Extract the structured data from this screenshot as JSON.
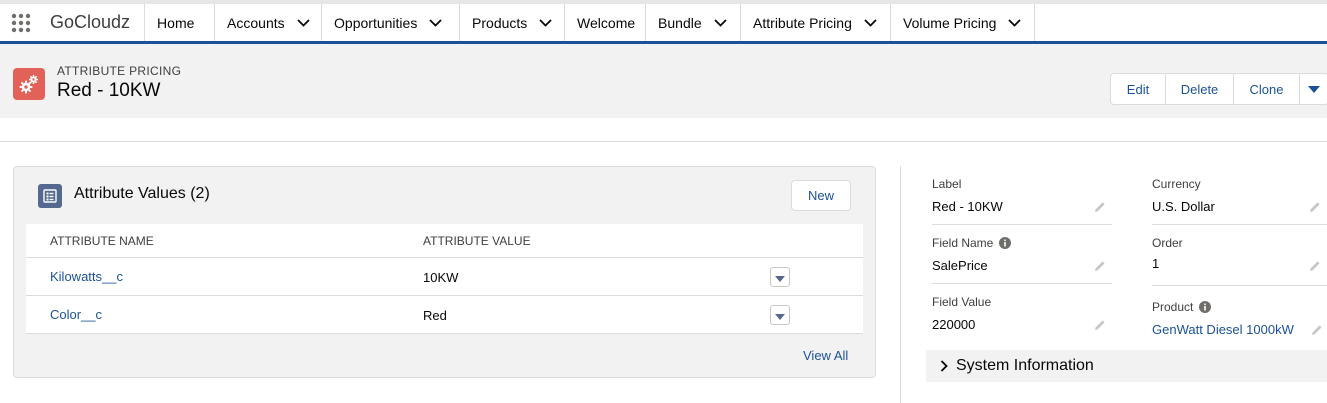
{
  "app": {
    "name": "GoCloudz",
    "nav": [
      {
        "label": "Home",
        "dropdown": false
      },
      {
        "label": "Accounts",
        "dropdown": true
      },
      {
        "label": "Opportunities",
        "dropdown": true
      },
      {
        "label": "Products",
        "dropdown": true
      },
      {
        "label": "Welcome",
        "dropdown": false
      },
      {
        "label": "Bundle",
        "dropdown": true
      },
      {
        "label": "Attribute Pricing",
        "dropdown": true
      },
      {
        "label": "Volume Pricing",
        "dropdown": true
      }
    ]
  },
  "record": {
    "object_type": "ATTRIBUTE PRICING",
    "title": "Red - 10KW",
    "icon": "gears-icon",
    "actions": {
      "edit": "Edit",
      "delete": "Delete",
      "clone": "Clone"
    }
  },
  "related_list": {
    "title": "Attribute Values (2)",
    "new_label": "New",
    "columns": [
      "ATTRIBUTE NAME",
      "ATTRIBUTE VALUE"
    ],
    "rows": [
      {
        "name": "Kilowatts__c",
        "value": "10KW"
      },
      {
        "name": "Color__c",
        "value": "Red"
      }
    ],
    "view_all": "View All"
  },
  "details": {
    "left": [
      {
        "label": "Label",
        "value": "Red - 10KW"
      },
      {
        "label": "Field Name",
        "value": "SalePrice"
      },
      {
        "label": "Field Value",
        "value": "220000"
      }
    ],
    "right": [
      {
        "label": "Currency",
        "value": "U.S. Dollar"
      },
      {
        "label": "Order",
        "value": "1"
      },
      {
        "label": "Product",
        "value": "GenWatt Diesel 1000kW"
      }
    ]
  },
  "system_info": {
    "label": "System Information"
  },
  "colors": {
    "brand": "#1b5297",
    "record_icon": "#e2625a",
    "card_icon": "#54698d"
  }
}
